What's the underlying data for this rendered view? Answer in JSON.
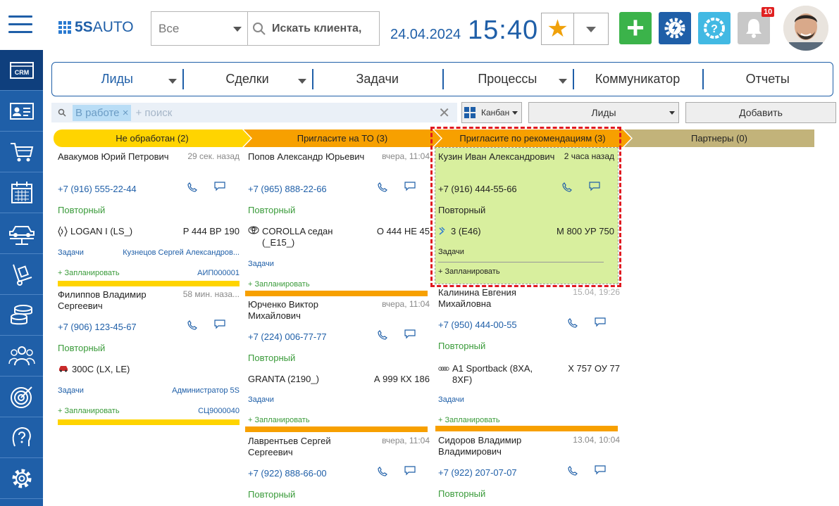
{
  "header": {
    "logo_text_bold": "5S",
    "logo_text": "AUTO",
    "scope_select": "Все",
    "search_placeholder": "Искать клиента,",
    "date": "24.04.2024",
    "time": "15:40",
    "notifications_count": "10"
  },
  "nav": {
    "tabs": [
      {
        "label": "Лиды",
        "dropdown": true
      },
      {
        "label": "Сделки",
        "dropdown": true
      },
      {
        "label": "Задачи",
        "dropdown": false
      },
      {
        "label": "Процессы",
        "dropdown": true
      },
      {
        "label": "Коммуникатор",
        "dropdown": false
      },
      {
        "label": "Отчеты",
        "dropdown": false
      }
    ]
  },
  "toolbar": {
    "filter_chip": "В работе",
    "filter_placeholder": "+ поиск",
    "view_select": "Канбан",
    "type_select": "Лиды",
    "add_button": "Добавить"
  },
  "sidebar": {
    "crm_label": "CRM"
  },
  "stages": [
    {
      "label": "Не обработан (2)",
      "color": "#ffd400"
    },
    {
      "label": "Пригласите на ТО  (3)",
      "color": "#f7a000"
    },
    {
      "label": "Пригласите по рекомендациям (3)",
      "color": "#f7a000"
    },
    {
      "label": "Партнеры (0)",
      "color": "#c2b37a"
    }
  ],
  "cards": {
    "c1": {
      "name": "Авакумов Юрий Петрович",
      "time": "29 сек. назад",
      "phone": "+7 (916) 555-22-44",
      "status": "Повторный",
      "car": "LOGAN I (LS_)",
      "plate": "Р 444 ВР 190",
      "tasks": "Задачи",
      "assignee": "Кузнецов Сергей Александров...",
      "plan": "+ Запланировать",
      "number": "АИП000001"
    },
    "c2": {
      "name": "Филиппов Владимир Сергеевич",
      "time": "58 мин. наза...",
      "phone": "+7 (906) 123-45-67",
      "status": "Повторный",
      "car": "300C (LX, LE)",
      "plate": "",
      "tasks": "Задачи",
      "assignee": "Администратор 5S",
      "plan": "+ Запланировать",
      "number": "СЦ9000040"
    },
    "c3": {
      "name": "Попов Александр Юрьевич",
      "time": "вчера, 11:04",
      "phone": "+7 (965) 888-22-66",
      "status": "Повторный",
      "car": "COROLLA седан (_E15_)",
      "plate": "О 444 НЕ 45",
      "tasks": "Задачи",
      "plan": "+ Запланировать"
    },
    "c4": {
      "name": "Юрченко Виктор Михайлович",
      "time": "вчера, 11:04",
      "phone": "+7 (224) 006-77-77",
      "status": "Повторный",
      "car": "GRANTA (2190_)",
      "plate": "А 999 КХ 186",
      "tasks": "Задачи",
      "plan": "+ Запланировать"
    },
    "c5": {
      "name": "Лаврентьев Сергей Сергеевич",
      "time": "вчера, 11:04",
      "phone": "+7 (922) 888-66-00",
      "status": "Повторный"
    },
    "c6": {
      "name": "Кузин Иван Александрович",
      "time": "2 часа назад",
      "phone": "+7 (916) 444-55-66",
      "status": "Повторный",
      "car": "3 (E46)",
      "plate": "М 800 УР 750",
      "tasks": "Задачи",
      "plan": "+ Запланировать"
    },
    "c7": {
      "name": "Калинина Евгения Михайловна",
      "time": "15.04, 19:26",
      "phone": "+7 (950) 444-00-55",
      "status": "Повторный",
      "car": "A1 Sportback (8XA, 8XF)",
      "plate": "Х 757 ОУ 77",
      "tasks": "Задачи",
      "plan": "+ Запланировать"
    },
    "c8": {
      "name": "Сидоров Владимир Владимирович",
      "time": "13.04, 10:04",
      "phone": "+7 (922) 207-07-07",
      "status": "Повторный"
    }
  },
  "colors": {
    "brand": "#1f5fa8",
    "green": "#3bb34a",
    "highlight": "#d8ef9e",
    "alert": "#e0191f"
  }
}
